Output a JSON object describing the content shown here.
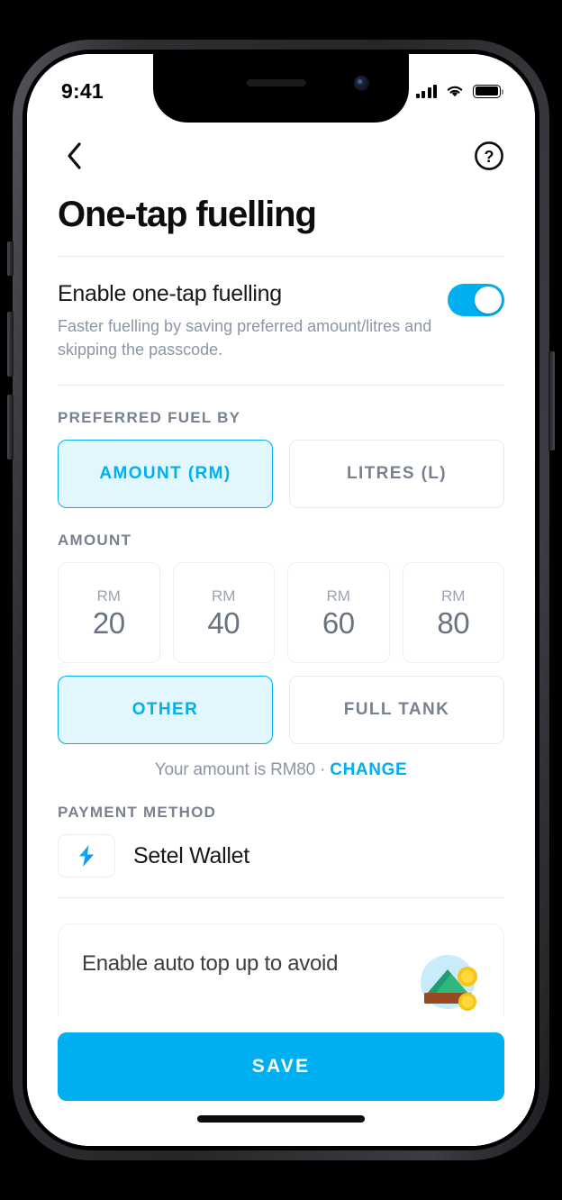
{
  "status_bar": {
    "time": "9:41",
    "signal_icon": "cellular-signal-icon",
    "wifi_icon": "wifi-icon",
    "battery_icon": "battery-full-icon"
  },
  "nav": {
    "back_icon": "chevron-left-icon",
    "help_icon": "question-mark-circle-icon"
  },
  "page": {
    "title": "One-tap fuelling"
  },
  "enable_section": {
    "title": "Enable one-tap fuelling",
    "description": "Faster fuelling by saving preferred amount/litres and skipping the passcode.",
    "toggle_on": true
  },
  "preferred_fuel_by": {
    "label": "PREFERRED FUEL BY",
    "options": [
      {
        "label": "AMOUNT (RM)",
        "selected": true
      },
      {
        "label": "LITRES (L)",
        "selected": false
      }
    ]
  },
  "amount_section": {
    "label": "AMOUNT",
    "currency": "RM",
    "presets": [
      {
        "currency": "RM",
        "value": "20",
        "selected": false
      },
      {
        "currency": "RM",
        "value": "40",
        "selected": false
      },
      {
        "currency": "RM",
        "value": "60",
        "selected": false
      },
      {
        "currency": "RM",
        "value": "80",
        "selected": false
      }
    ],
    "other_options": [
      {
        "label": "OTHER",
        "selected": true
      },
      {
        "label": "FULL TANK",
        "selected": false
      }
    ],
    "note_text": "Your amount is RM80 · ",
    "note_link": "CHANGE"
  },
  "payment_method": {
    "label": "PAYMENT METHOD",
    "name": "Setel Wallet",
    "icon": "setel-lightning-bolt-icon"
  },
  "promo_card": {
    "text": "Enable auto top up to avoid",
    "art": "money-coins-illustration"
  },
  "bottom": {
    "save_label": "SAVE"
  },
  "colors": {
    "accent": "#00AFF0",
    "accent_soft": "#E2F6FE",
    "text_primary": "#17181A",
    "text_muted": "#8B96A5",
    "border": "#E7EBF0"
  }
}
